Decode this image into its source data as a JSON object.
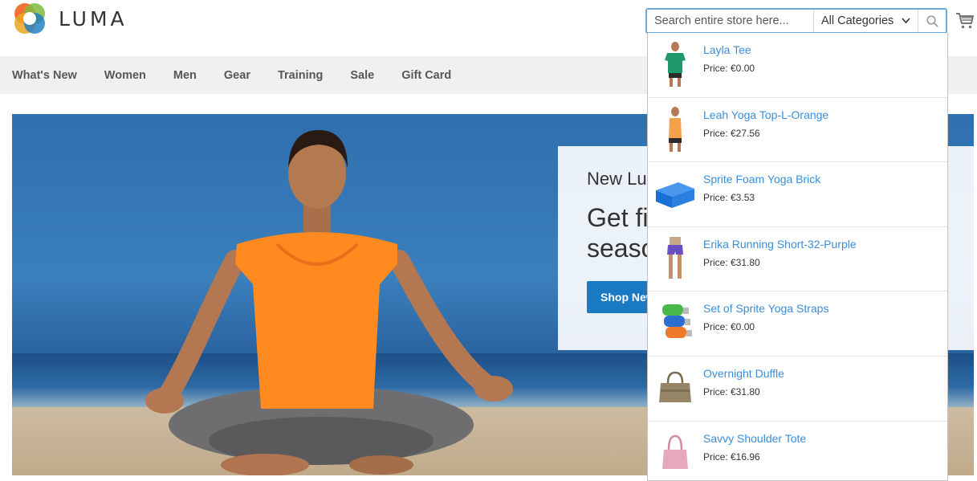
{
  "brand": {
    "name": "LUMA"
  },
  "search": {
    "placeholder": "Search entire store here...",
    "category": "All Categories"
  },
  "icons": {
    "logo": "luma-logo-icon",
    "search": "search-icon",
    "cart": "cart-icon",
    "chevron": "chevron-down-icon"
  },
  "nav": {
    "items": [
      {
        "label": "What's New"
      },
      {
        "label": "Women"
      },
      {
        "label": "Men"
      },
      {
        "label": "Gear"
      },
      {
        "label": "Training"
      },
      {
        "label": "Sale"
      },
      {
        "label": "Gift Card"
      }
    ]
  },
  "hero": {
    "subtitle": "New Lu",
    "title_line1": "Get fi",
    "title_line2": "seaso",
    "button_label": "Shop New"
  },
  "autocomplete": {
    "items": [
      {
        "name": "Layla Tee",
        "price": "Price: €0.00",
        "thumb": "green-tee"
      },
      {
        "name": "Leah Yoga Top-L-Orange",
        "price": "Price: €27.56",
        "thumb": "orange-tank"
      },
      {
        "name": "Sprite Foam Yoga Brick",
        "price": "Price: €3.53",
        "thumb": "blue-brick"
      },
      {
        "name": "Erika Running Short-32-Purple",
        "price": "Price: €31.80",
        "thumb": "purple-shorts"
      },
      {
        "name": "Set of Sprite Yoga Straps",
        "price": "Price: €0.00",
        "thumb": "yoga-straps"
      },
      {
        "name": "Overnight Duffle",
        "price": "Price: €31.80",
        "thumb": "duffle-bag"
      },
      {
        "name": "Savvy Shoulder Tote",
        "price": "Price: €16.96",
        "thumb": "tote-bag"
      }
    ]
  },
  "colors": {
    "accent": "#1979c3",
    "link": "#3a8ed8",
    "nav_bg": "#f0f0f0",
    "search_border": "#6aa9d8"
  }
}
